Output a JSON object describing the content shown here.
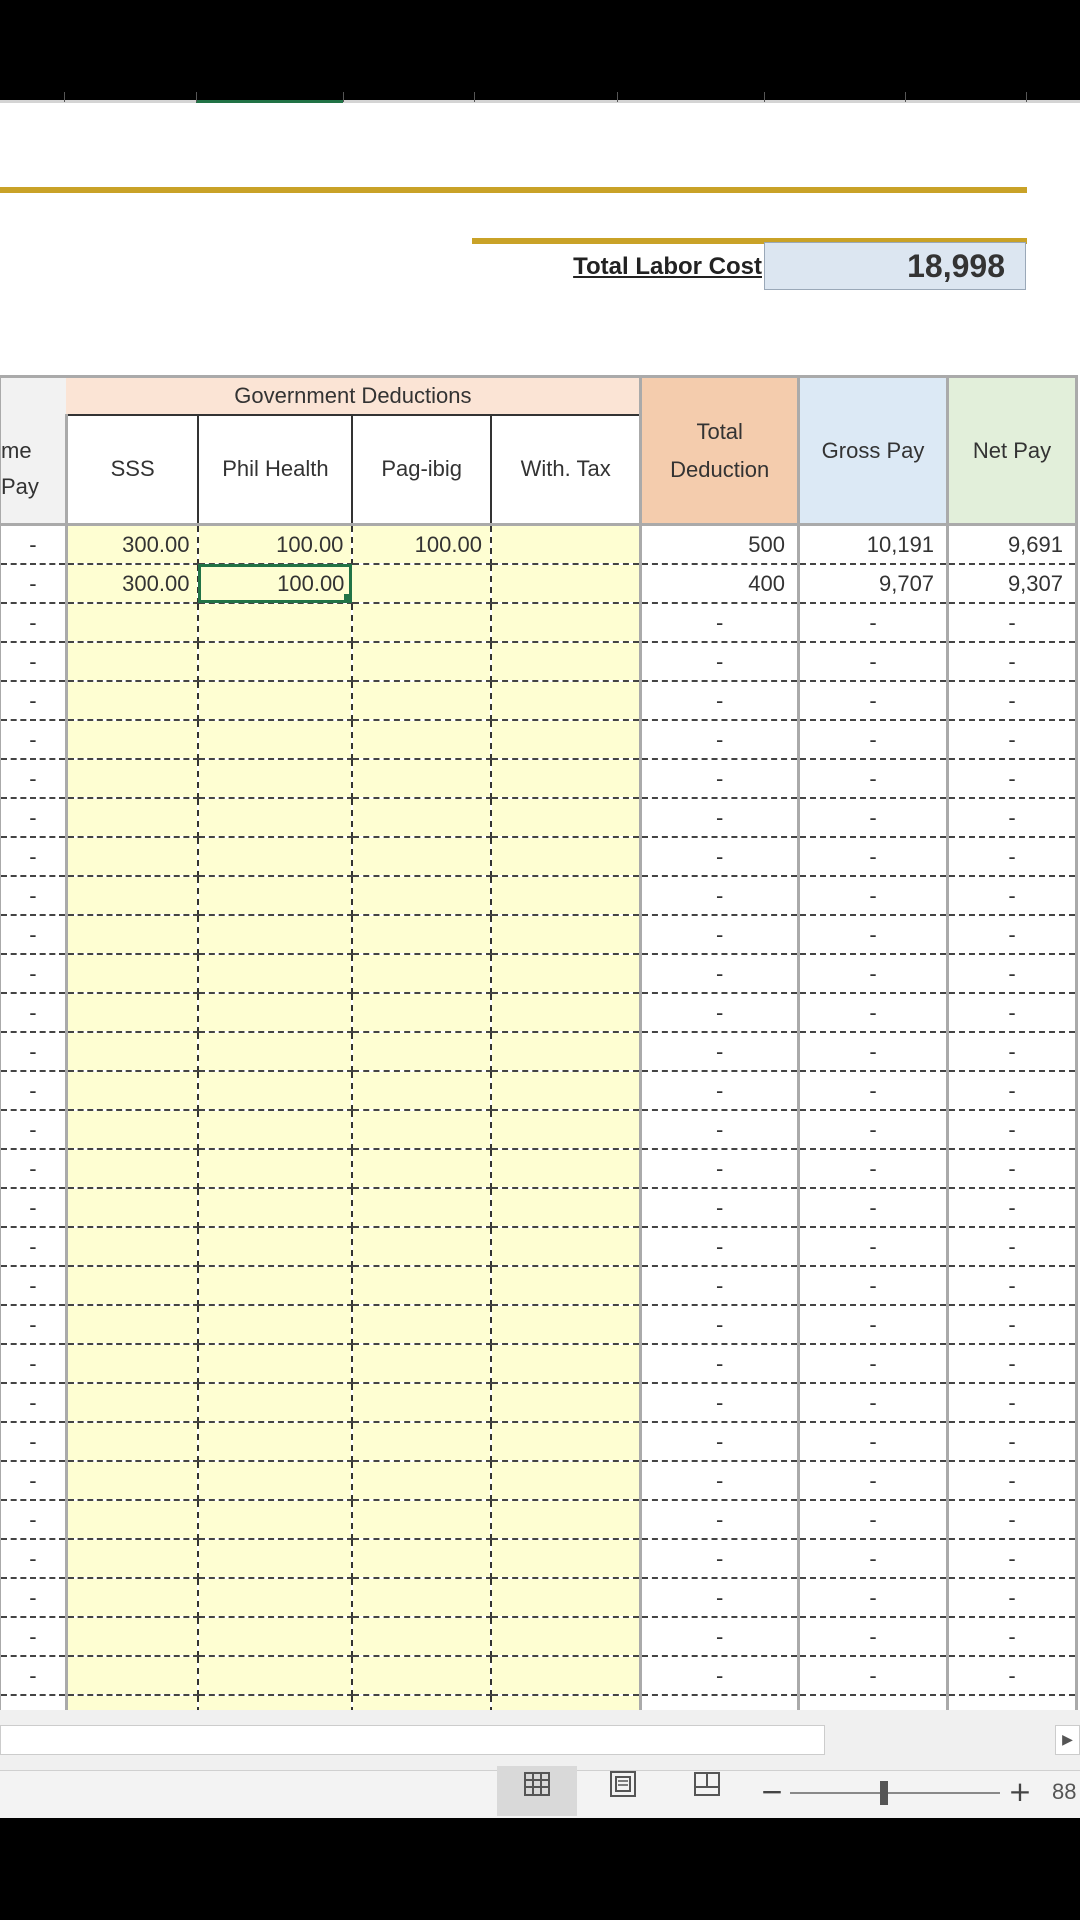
{
  "summary": {
    "total_labor_cost_label": "Total Labor Cost",
    "total_labor_cost_value": "18,998"
  },
  "headers": {
    "ot_pay_line1": "me",
    "ot_pay_line2": "Pay",
    "group_label": "Government Deductions",
    "sss": "SSS",
    "phil_health": "Phil Health",
    "pag_ibig": "Pag-ibig",
    "with_tax": "With. Tax",
    "total_deduction_line1": "Total",
    "total_deduction_line2": "Deduction",
    "gross_pay": "Gross Pay",
    "net_pay": "Net Pay"
  },
  "rows": [
    {
      "ot": "-",
      "sss": "300.00",
      "phil": "100.00",
      "pag": "100.00",
      "wtax": "",
      "total": "500",
      "gross": "10,191",
      "net": "9,691"
    },
    {
      "ot": "-",
      "sss": "300.00",
      "phil": "100.00",
      "pag": "",
      "wtax": "",
      "total": "400",
      "gross": "9,707",
      "net": "9,307"
    }
  ],
  "empty_row_count": 29,
  "empty_cell": "-",
  "statusbar": {
    "zoom_percent": "88",
    "views": [
      "normal-view",
      "page-layout-view",
      "page-break-preview"
    ],
    "active_view": "normal-view",
    "zoom_minus": "−",
    "zoom_plus": "+",
    "scroll_right": "▶"
  },
  "colors": {
    "accent_green": "#217346",
    "gold": "#c9a227",
    "deductions_fill": "#fefed2",
    "total_deduction_header": "#f4ccad",
    "gross_pay_header": "#dce9f5",
    "net_pay_header": "#e2efda",
    "group_header": "#fbe4d5"
  }
}
